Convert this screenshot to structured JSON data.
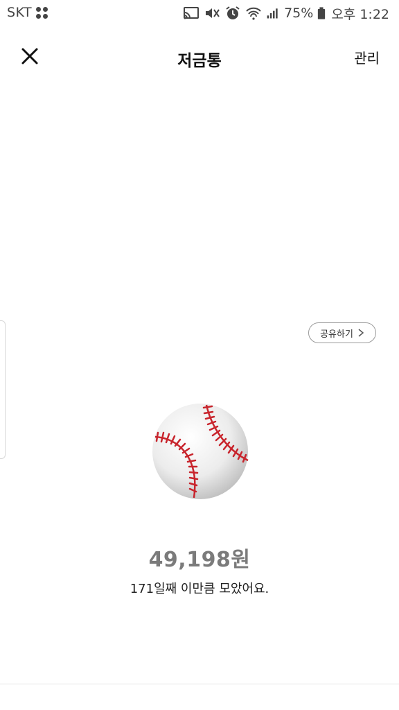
{
  "status_bar": {
    "carrier": "SKT",
    "battery_percent": "75%",
    "time": "오후 1:22"
  },
  "header": {
    "title": "저금통",
    "manage_label": "관리",
    "close_icon": "close-icon"
  },
  "content": {
    "share_label": "공유하기",
    "amount": "49,198원",
    "caption": "171일째 이만큼 모았어요.",
    "emoji": "baseball-icon"
  },
  "colors": {
    "amount": "#7b7b7b",
    "stitch": "#c8242c"
  }
}
